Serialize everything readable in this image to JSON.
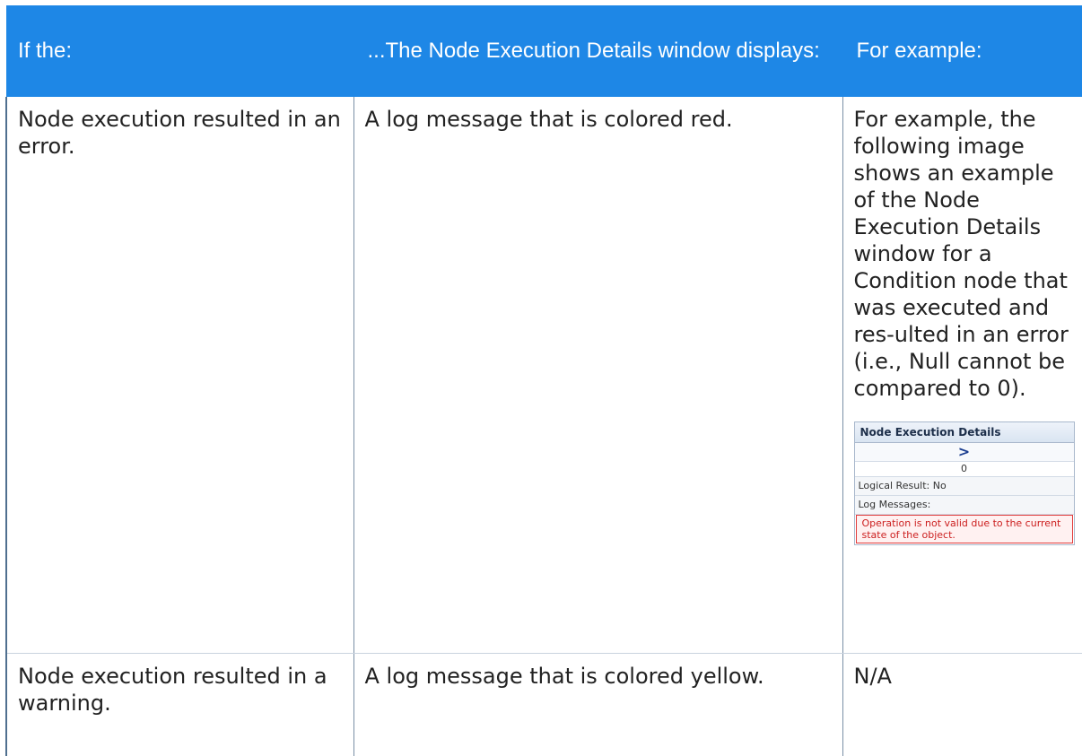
{
  "table": {
    "headers": [
      "If the:",
      "...The Node Execution Details window displays:",
      "For example:"
    ],
    "rows": [
      {
        "condition": "Node execution resulted in an error.",
        "display": "A log message that is colored red.",
        "example": "For example, the following image shows an example of the Node Execution Details window for a Condition node that was executed and res-ulted in an error (i.e., Null cannot be compared to 0)."
      },
      {
        "condition": "Node execution resulted in a warning.",
        "display": "A log message that is colored yellow.",
        "example": "N/A"
      }
    ]
  },
  "example_image": {
    "title": "Node Execution Details",
    "operator": ">",
    "value": "0",
    "logical_result": "Logical Result: No",
    "log_messages_label": "Log Messages:",
    "error_message": "Operation is not valid due to the current state of the object."
  },
  "colors": {
    "header_bg": "#1e87e6",
    "header_text": "#ffffff",
    "error_text": "#cc1f1f",
    "error_border": "#e23c3c"
  }
}
